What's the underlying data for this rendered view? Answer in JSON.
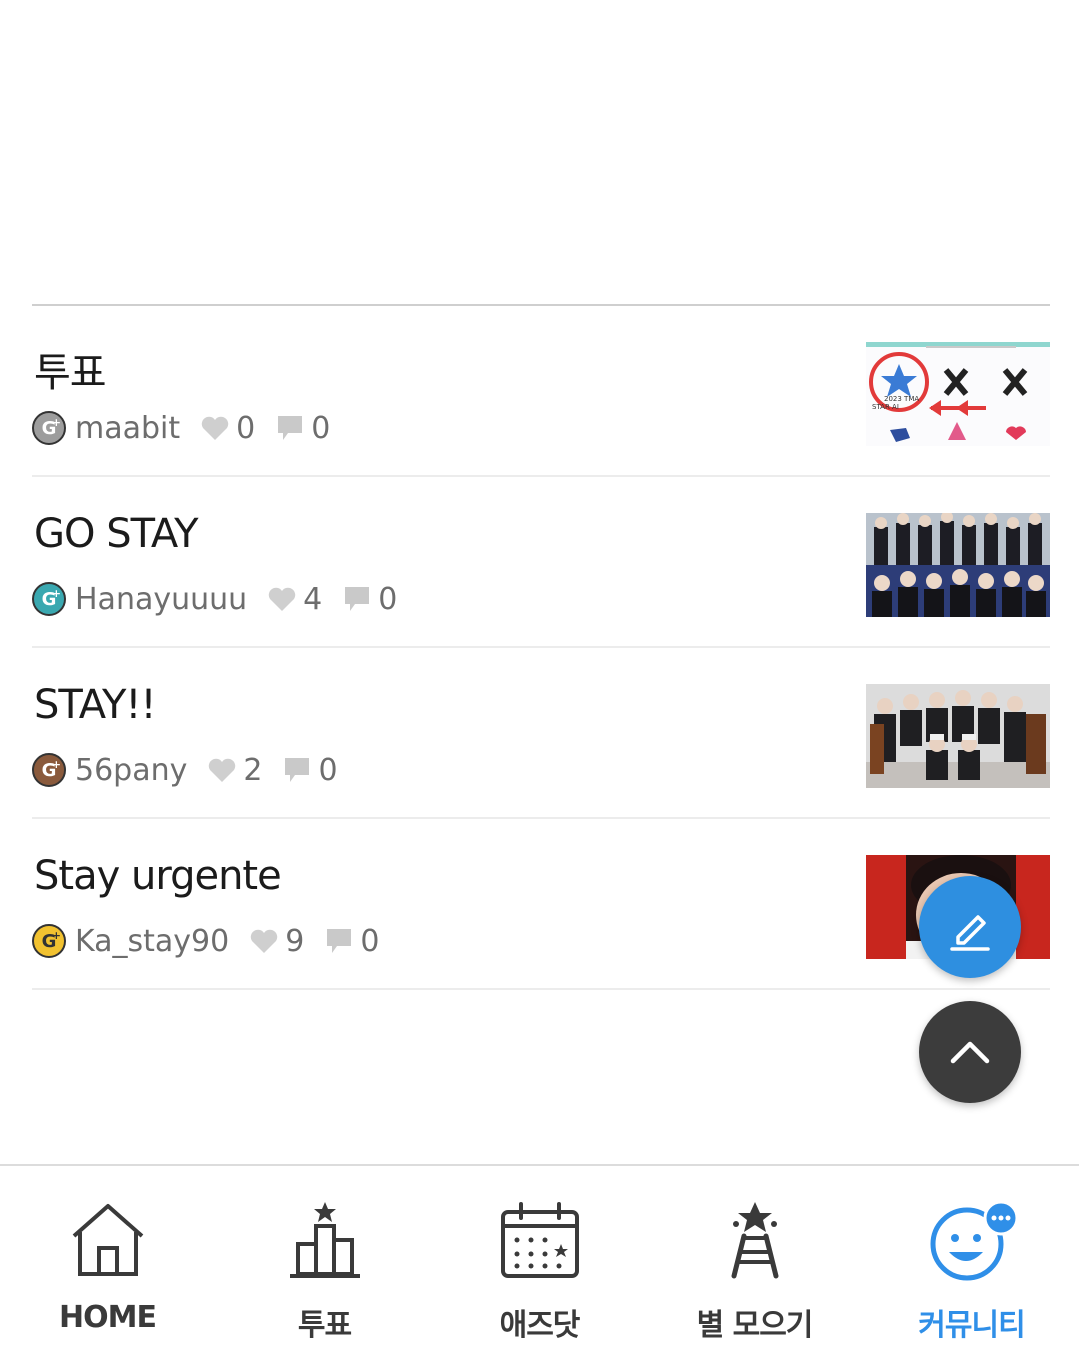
{
  "posts": [
    {
      "title": "투표",
      "author": "maabit",
      "likes": "0",
      "comments": "0",
      "grade_color": "gray",
      "thumb": "vote-screenshot"
    },
    {
      "title": "GO STAY",
      "author": "Hanayuuuu",
      "likes": "4",
      "comments": "0",
      "grade_color": "teal",
      "thumb": "group-photo"
    },
    {
      "title": "STAY!!",
      "author": "56pany",
      "likes": "2",
      "comments": "0",
      "grade_color": "brown",
      "thumb": "group-photo-2"
    },
    {
      "title": "Stay urgente",
      "author": "Ka_stay90",
      "likes": "9",
      "comments": "0",
      "grade_color": "gold",
      "thumb": "portrait-photo"
    }
  ],
  "grade_badge": {
    "letter": "G",
    "plus": "+"
  },
  "thumb_texts": {
    "vote_label_1": "2023 TMA",
    "vote_label_2": "STAR AI"
  },
  "fab": {
    "write_icon": "pencil-icon",
    "top_icon": "chevron-up-icon"
  },
  "nav": {
    "items": [
      {
        "label": "HOME",
        "icon": "home-icon"
      },
      {
        "label": "투표",
        "icon": "vote-chart-icon"
      },
      {
        "label": "애즈닷",
        "icon": "calendar-icon"
      },
      {
        "label": "별 모으기",
        "icon": "star-tower-icon"
      },
      {
        "label": "커뮤니티",
        "icon": "community-face-icon"
      }
    ],
    "active_color": "#2f8fe8"
  }
}
